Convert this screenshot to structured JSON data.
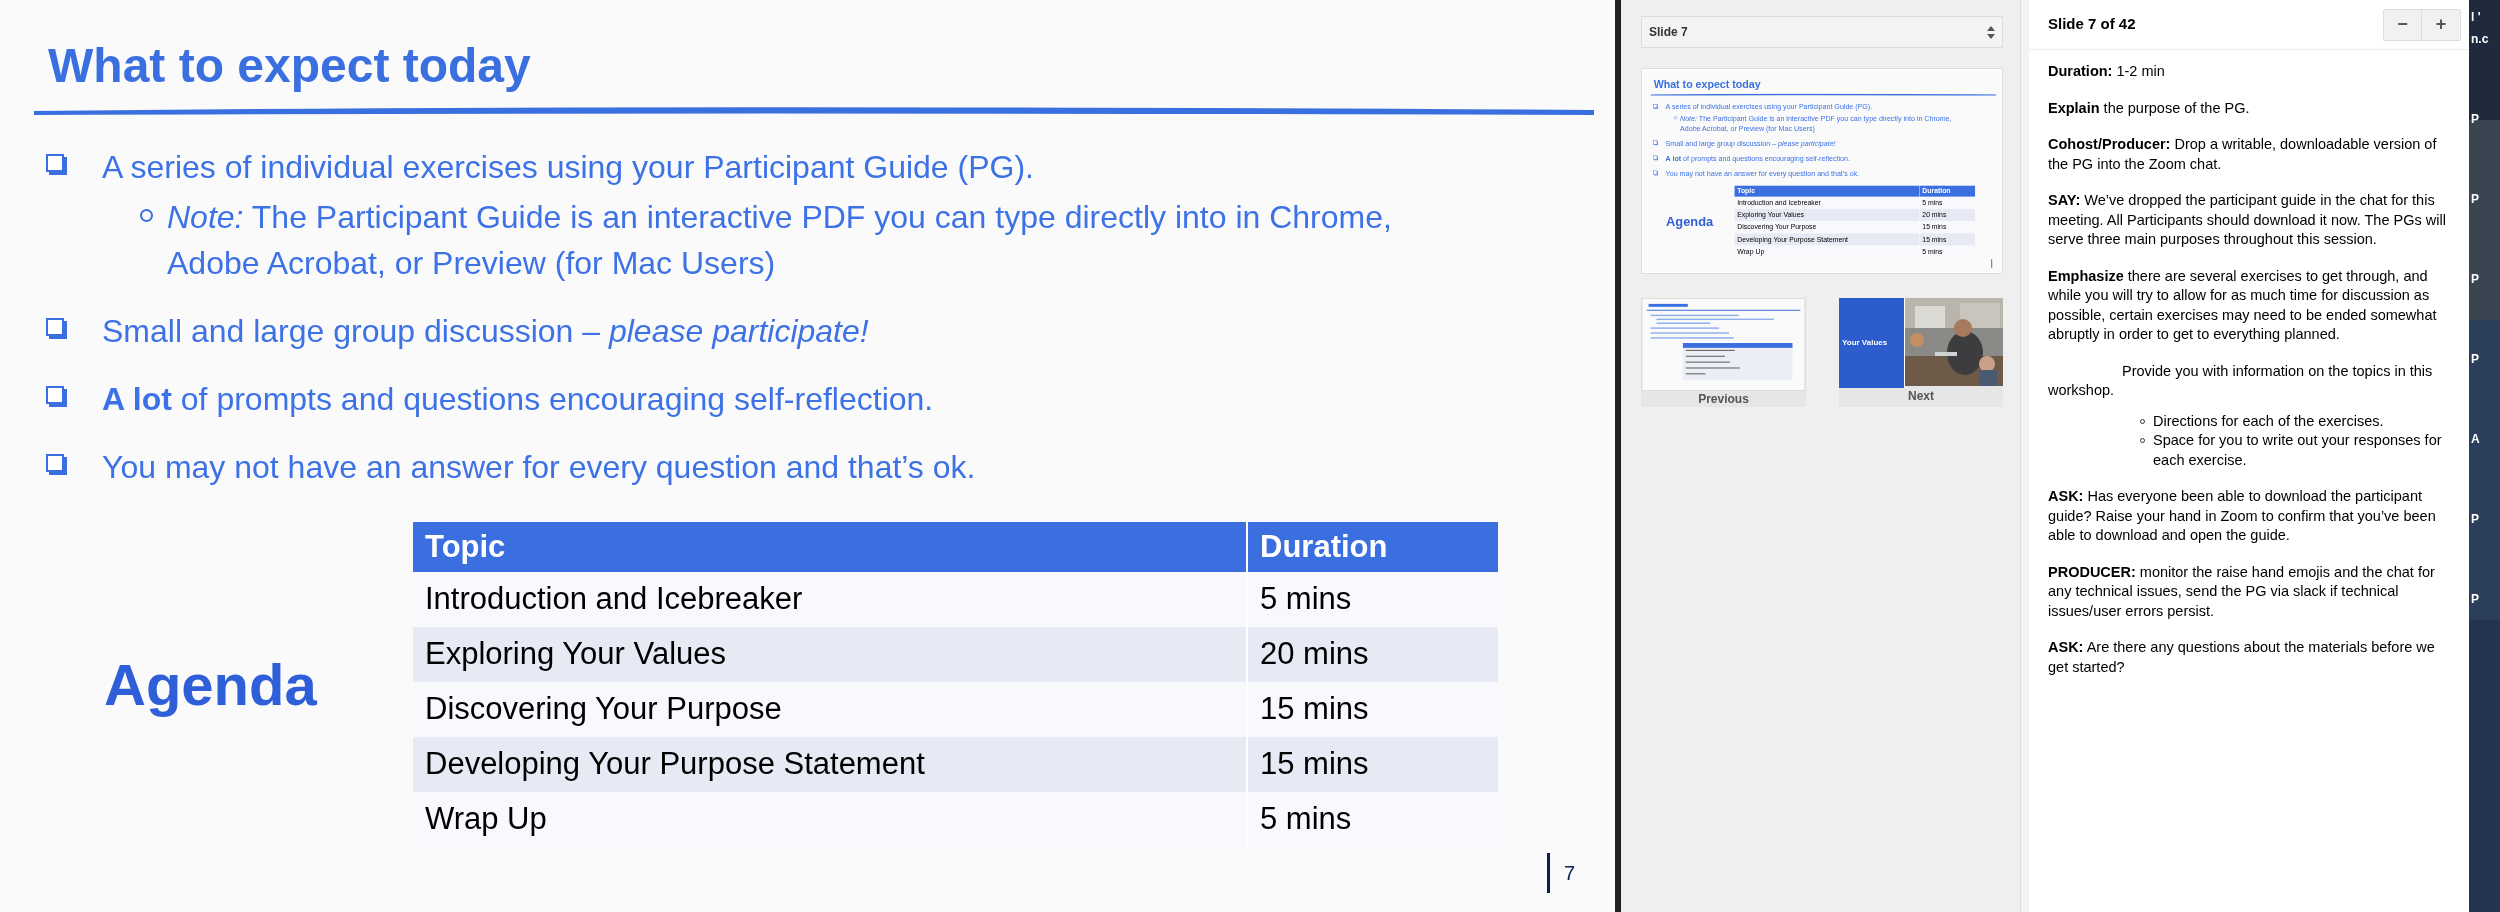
{
  "slide": {
    "title": "What to expect today",
    "bullets": [
      {
        "kind": "square",
        "text": "A series of individual exercises using your Participant Guide (PG).",
        "children": [
          {
            "kind": "circle",
            "text": "*Note:* The Participant Guide is an interactive PDF you can type directly into in Chrome, Adobe Acrobat, or Preview (for Mac Users)"
          }
        ]
      },
      {
        "kind": "square",
        "text": "Small and large group discussion – *please participate!*"
      },
      {
        "kind": "square",
        "text": "**A lot** of prompts and questions encouraging self-reflection."
      },
      {
        "kind": "square",
        "text": "You may not have an answer for every question and that’s ok."
      }
    ],
    "agenda_label": "Agenda",
    "table": {
      "columns": [
        "Topic",
        "Duration"
      ],
      "rows": [
        [
          "Introduction and Icebreaker",
          "5 mins"
        ],
        [
          "Exploring Your Values",
          "20 mins"
        ],
        [
          "Discovering Your Purpose",
          "15 mins"
        ],
        [
          "Developing Your Purpose Statement",
          "15 mins"
        ],
        [
          "Wrap Up",
          "5 mins"
        ]
      ]
    },
    "page_number": "7"
  },
  "presenter": {
    "slide_select": "Slide 7",
    "current_slide": {
      "title": "What to expect today",
      "bullets": [
        {
          "kind": "square",
          "text": "A series of individual exercises using your Participant Guide (PG).",
          "children": [
            {
              "kind": "circle",
              "text": "*Note:* The Participant Guide is an interactive PDF you can type directly into in Chrome, Adobe Acrobat, or Preview (for Mac Users)"
            }
          ]
        },
        {
          "kind": "square",
          "text": "Small and large group discussion – *please participate!*"
        },
        {
          "kind": "square",
          "text": "**A lot** of prompts and questions encouraging self-reflection."
        },
        {
          "kind": "square",
          "text": "You may not have an answer for every question and that’s ok."
        }
      ],
      "agenda_label": "Agenda",
      "table": {
        "columns": [
          "Topic",
          "Duration"
        ],
        "rows": [
          [
            "Introduction and Icebreaker",
            "5 mins"
          ],
          [
            "Exploring Your Values",
            "20 mins"
          ],
          [
            "Discovering Your Purpose",
            "15 mins"
          ],
          [
            "Developing Your Purpose Statement",
            "15 mins"
          ],
          [
            "Wrap Up",
            "5 mins"
          ]
        ]
      }
    },
    "previous": {
      "label": "Previous"
    },
    "next": {
      "label": "Next",
      "slide_title": "Your Values"
    }
  },
  "notes": {
    "header": "Slide 7 of 42",
    "zoom_out": "−",
    "zoom_in": "+",
    "blocks": [
      {
        "kind": "para",
        "text": "**Duration:** 1-2 min"
      },
      {
        "kind": "para",
        "text": "**Explain** the purpose of the PG."
      },
      {
        "kind": "para",
        "text": "**Cohost/Producer:** Drop a writable, downloadable version of the PG into the Zoom chat."
      },
      {
        "kind": "para",
        "text": "**SAY:** We’ve dropped the participant guide in the chat for this meeting. All Participants should download it now. The PGs will serve three main purposes throughout this session."
      },
      {
        "kind": "para",
        "text": "**Emphasize** there are several exercises to get through, and while you will try to allow for as much time for discussion as possible, certain exercises may need to be ended somewhat abruptly in order to get to everything planned."
      },
      {
        "kind": "indented",
        "text": "Provide you with information on the topics in this workshop."
      },
      {
        "kind": "list",
        "items": [
          "Directions for each of the exercises.",
          "Space for you to write out your responses for each exercise."
        ]
      },
      {
        "kind": "para",
        "text": "**ASK:** Has everyone been able to download the participant guide? Raise your hand in Zoom to confirm that you’ve been able to download and open the guide."
      },
      {
        "kind": "para",
        "text": "**PRODUCER:** monitor the raise hand emojis and the chat for any technical issues, send the PG via slack if technical issues/user errors persist."
      },
      {
        "kind": "para",
        "text": "**ASK:** Are there any questions about the materials before we get started?"
      }
    ]
  },
  "desktop": {
    "fragments": [
      "l '",
      "n.c",
      "P",
      "P",
      "P",
      "P",
      "A",
      "P",
      "P"
    ]
  }
}
